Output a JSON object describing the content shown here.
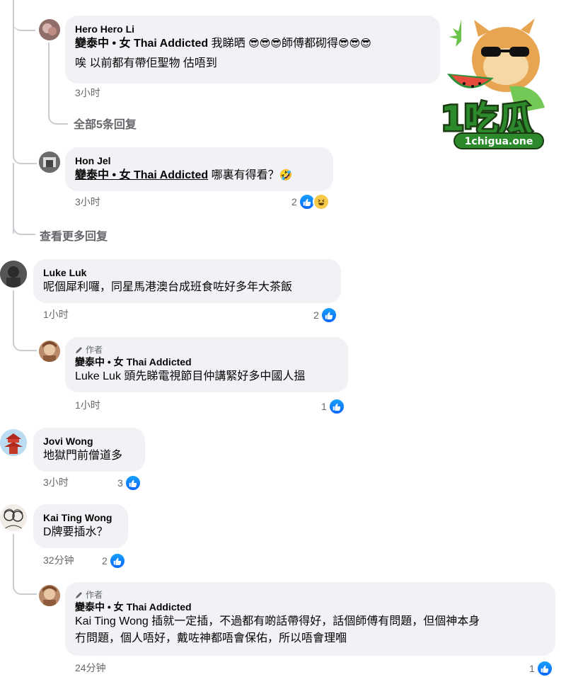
{
  "colors": {
    "like": "#0866ff",
    "bubble": "#f0f2f5",
    "meta": "#65676b"
  },
  "comments": [
    {
      "author": "Hero Hero Li",
      "mention": "變泰中 • 女 Thai Addicted",
      "text": "我睇晒",
      "emojis_a": "😎😎😎",
      "text2": "師傅都砌得",
      "emojis_b": "😎😎😎",
      "line2": "唉 以前都有帶佢聖物 估唔到",
      "time": "3小时"
    },
    {
      "view_replies": "全部5条回复"
    },
    {
      "author": "Hon Jel",
      "mention": "變泰中 • 女 Thai Addicted",
      "text": "哪裏有得看？",
      "emoji": "🤣",
      "time": "3小时",
      "reactions": "2"
    },
    {
      "view_more": "查看更多回复"
    },
    {
      "author": "Luke Luk",
      "text": "呢個犀利囉，同星馬港澳台成班食咗好多年大茶飯",
      "time": "1小时",
      "reactions": "2"
    },
    {
      "badge": "作者",
      "author": "變泰中 • 女 Thai Addicted",
      "mention": "Luke Luk",
      "text": "頭先睇電視節目仲講緊好多中國人搵",
      "time": "1小时",
      "reactions": "1"
    },
    {
      "author": "Jovi Wong",
      "text": "地獄門前僧道多",
      "time": "3小时",
      "reactions": "3"
    },
    {
      "author": "Kai Ting Wong",
      "text": "D牌要插水？",
      "time": "32分钟",
      "reactions": "2"
    },
    {
      "badge": "作者",
      "author": "變泰中 • 女 Thai Addicted",
      "mention": "Kai Ting Wong",
      "text": "插就一定插，不過都有啲話帶得好，話個師傅有問題，但個神本身",
      "line2": "冇問題，個人唔好，戴咗神都唔會保佑，所以唔會理嗰",
      "time": "24分钟",
      "reactions": "1"
    }
  ],
  "logo": {
    "text": "1吃瓜",
    "sub": "1chigua.one"
  }
}
